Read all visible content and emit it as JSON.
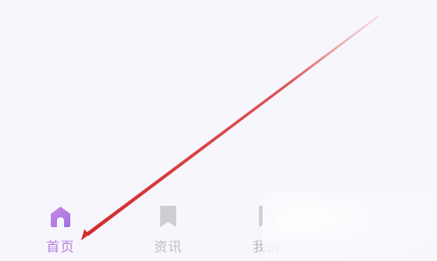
{
  "tab_bar": {
    "tabs": [
      {
        "label": "首页",
        "icon": "home-icon",
        "active": true
      },
      {
        "label": "资讯",
        "icon": "bookmark-icon",
        "active": false
      },
      {
        "label": "我的",
        "icon": "bookmark-icon",
        "active": false
      }
    ]
  },
  "colors": {
    "background": "#f7f6fd",
    "active": "#b57ee0",
    "inactive": "#bdbdbd",
    "annotation_arrow": "#d42a2a"
  }
}
